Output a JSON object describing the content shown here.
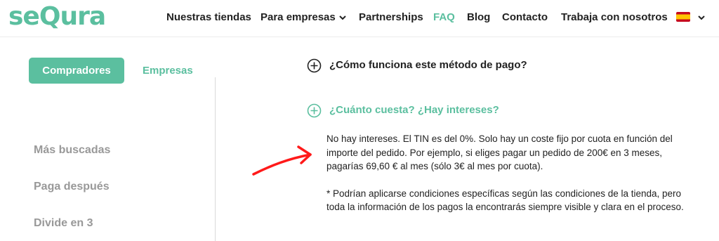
{
  "brand": {
    "logo_text": "seQura",
    "accent_color": "#5bbf9f"
  },
  "nav": {
    "items": [
      "Nuestras tiendas",
      "Para empresas",
      "Partnerships",
      "FAQ",
      "Blog",
      "Contacto",
      "Trabaja con nosotros"
    ],
    "active": "FAQ",
    "language_flag": "spain-flag-icon"
  },
  "tabs": {
    "compradores": "Compradores",
    "empresas": "Empresas"
  },
  "sidebar": {
    "items": [
      "Más buscadas",
      "Paga después",
      "Divide en 3"
    ]
  },
  "faq": {
    "q1": "¿Cómo funciona este método de pago?",
    "q2": "¿Cuánto cuesta? ¿Hay intereses?",
    "answer_p1": "No hay intereses. El TIN es del 0%. Solo hay un coste fijo por cuota en función del importe del pedido. Por ejemplo, si eliges pagar un pedido de 200€ en 3 meses, pagarías 69,60 € al mes (sólo 3€ al mes por cuota).",
    "answer_p2": "* Podrían aplicarse condiciones específicas según las condiciones de la tienda, pero toda la información de los pagos la encontrarás siempre visible y clara en el proceso."
  },
  "annotation_color": "#ff1a1a"
}
